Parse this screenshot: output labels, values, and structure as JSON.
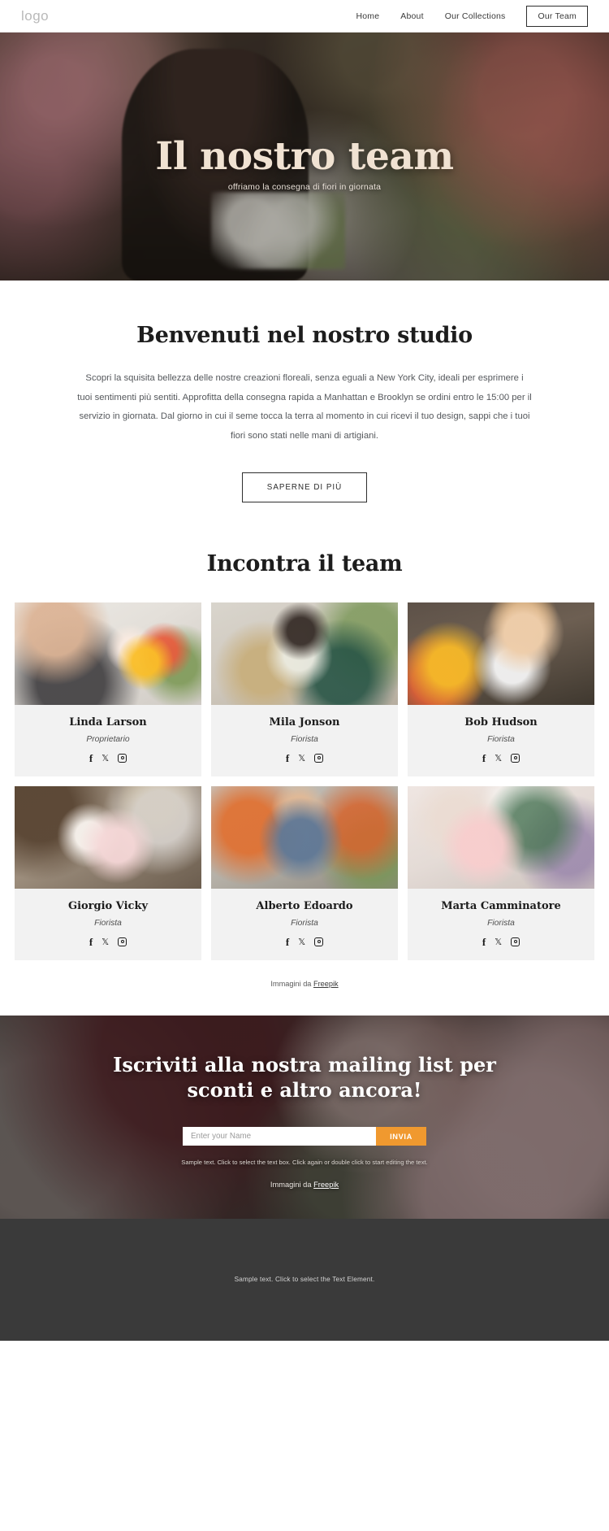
{
  "header": {
    "logo": "logo",
    "nav": [
      {
        "label": "Home",
        "active": false
      },
      {
        "label": "About",
        "active": false
      },
      {
        "label": "Our Collections",
        "active": false
      },
      {
        "label": "Our Team",
        "active": true
      }
    ]
  },
  "hero": {
    "title": "Il nostro team",
    "subtitle": "offriamo la consegna di fiori in giornata"
  },
  "welcome": {
    "heading": "Benvenuti nel nostro studio",
    "body": "Scopri la squisita bellezza delle nostre creazioni floreali, senza eguali a New York City, ideali per esprimere i tuoi sentimenti più sentiti. Approfitta della consegna rapida a Manhattan e Brooklyn se ordini entro le 15:00 per il servizio in giornata. Dal giorno in cui il seme tocca la terra al momento in cui ricevi il tuo design, sappi che i tuoi fiori sono stati nelle mani di artigiani.",
    "cta": "SAPERNE DI PIÙ"
  },
  "team": {
    "heading": "Incontra il team",
    "socials": [
      "facebook-icon",
      "x-twitter-icon",
      "instagram-icon"
    ],
    "members": [
      {
        "name": "Linda Larson",
        "role": "Proprietario"
      },
      {
        "name": "Mila Jonson",
        "role": "Fiorista"
      },
      {
        "name": "Bob Hudson",
        "role": "Fiorista"
      },
      {
        "name": "Giorgio Vicky",
        "role": "Fiorista"
      },
      {
        "name": "Alberto Edoardo",
        "role": "Fiorista"
      },
      {
        "name": "Marta Camminatore",
        "role": "Fiorista"
      }
    ],
    "credit_prefix": "Immagini da ",
    "credit_link": "Freepik"
  },
  "newsletter": {
    "title_line1": "Iscriviti alla nostra mailing list per",
    "title_line2": "sconti e altro ancora!",
    "input_placeholder": "Enter your Name",
    "input_value": "",
    "submit_label": "INVIA",
    "note": "Sample text. Click to select the text box. Click again or double click to start editing the text.",
    "credit_prefix": "Immagini da ",
    "credit_link": "Freepik",
    "accent_color": "#f0992f"
  },
  "footer": {
    "note": "Sample text. Click to select the Text Element."
  }
}
